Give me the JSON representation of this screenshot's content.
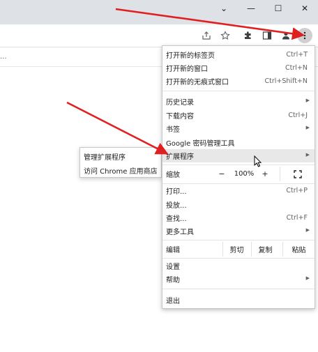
{
  "window_controls": {
    "dropdown": "⌄",
    "minimize": "—",
    "maximize": "☐",
    "close": "✕"
  },
  "bookmarks_bar": {
    "overflow": "..."
  },
  "menu": {
    "new_tab": {
      "label": "打开新的标签页",
      "shortcut": "Ctrl+T"
    },
    "new_window": {
      "label": "打开新的窗口",
      "shortcut": "Ctrl+N"
    },
    "new_incognito": {
      "label": "打开新的无痕式窗口",
      "shortcut": "Ctrl+Shift+N"
    },
    "history": {
      "label": "历史记录"
    },
    "downloads": {
      "label": "下载内容",
      "shortcut": "Ctrl+J"
    },
    "bookmarks": {
      "label": "书签"
    },
    "password_manager": {
      "label": "Google 密码管理工具"
    },
    "extensions": {
      "label": "扩展程序"
    },
    "zoom": {
      "label": "缩放",
      "minus": "−",
      "value": "100%",
      "plus": "+"
    },
    "print": {
      "label": "打印...",
      "shortcut": "Ctrl+P"
    },
    "cast": {
      "label": "投放..."
    },
    "find": {
      "label": "查找...",
      "shortcut": "Ctrl+F"
    },
    "more_tools": {
      "label": "更多工具"
    },
    "edit": {
      "label": "编辑",
      "cut": "剪切",
      "copy": "复制",
      "paste": "粘贴"
    },
    "settings": {
      "label": "设置"
    },
    "help": {
      "label": "帮助"
    },
    "exit": {
      "label": "退出"
    }
  },
  "extensions_submenu": {
    "manage": "管理扩展程序",
    "store": "访问 Chrome 应用商店"
  },
  "colors": {
    "annotation_arrow": "#e02020",
    "highlight": "#e8e8e8"
  }
}
